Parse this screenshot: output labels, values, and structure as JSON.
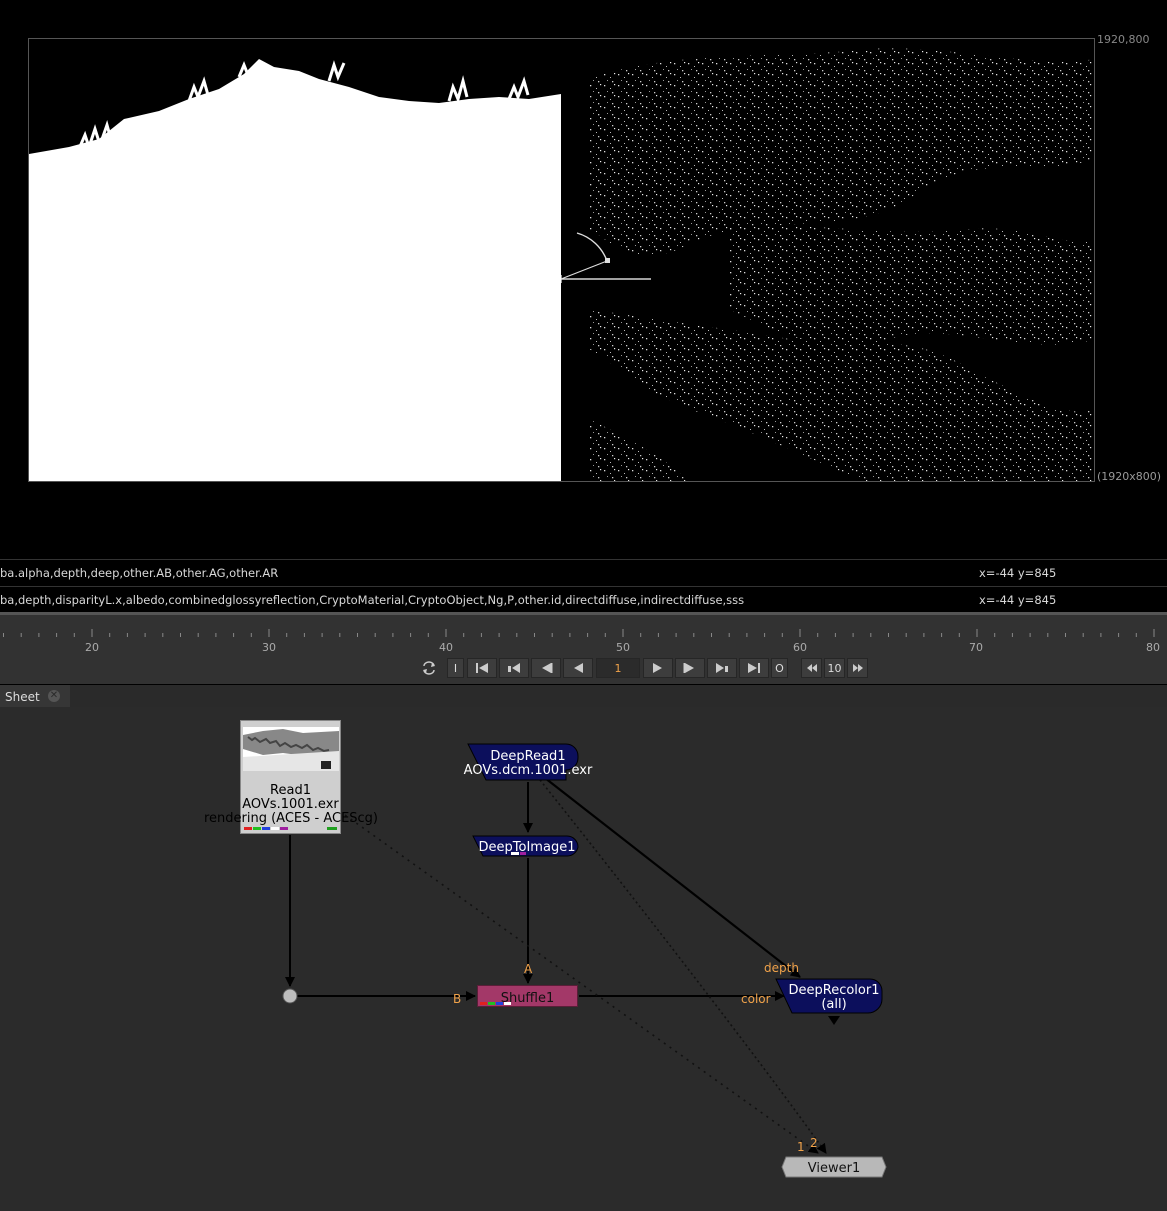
{
  "viewer": {
    "format_top_right": "1920,800",
    "format_bottom_right": "(1920x800)"
  },
  "info_bars": [
    {
      "channels": "ba.alpha,depth,deep,other.AB,other.AG,other.AR",
      "coords": "x=-44 y=845"
    },
    {
      "channels": "ba,depth,disparityL.x,albedo,combinedglossyreflection,CryptoMaterial,CryptoObject,Ng,P,other.id,directdiffuse,indirectdiffuse,sss",
      "coords": "x=-44 y=845"
    }
  ],
  "timeline": {
    "ticks": [
      "20",
      "30",
      "40",
      "50",
      "60",
      "70",
      "80"
    ],
    "current_frame": "1",
    "in_button": "I",
    "out_button": "O",
    "step": "10"
  },
  "node_graph": {
    "tab_label": "Sheet",
    "nodes": {
      "read": {
        "name": "Read1",
        "file": "AOVs.1001.exr",
        "colorspace": "rendering (ACES - ACEScg)"
      },
      "deepread": {
        "name": "DeepRead1",
        "file": "AOVs.dcm.1001.exr"
      },
      "deeptoimage": {
        "name": "DeepToImage1"
      },
      "shuffle": {
        "name": "Shuffle1"
      },
      "deeprecolor": {
        "name": "DeepRecolor1",
        "sub": "(all)"
      },
      "viewer": {
        "name": "Viewer1"
      }
    },
    "pipe_labels": {
      "a": "A",
      "b": "B",
      "depth": "depth",
      "color": "color",
      "v1": "1",
      "v2": "2"
    }
  },
  "colors": {
    "deep_node": "#0c0f5c",
    "shuffle_node": "#a33868",
    "viewer_node": "#b8b8b8",
    "read_node": "#cfcfcf",
    "pipe_label": "#f0a24a",
    "graph_bg": "#2b2b2b"
  }
}
